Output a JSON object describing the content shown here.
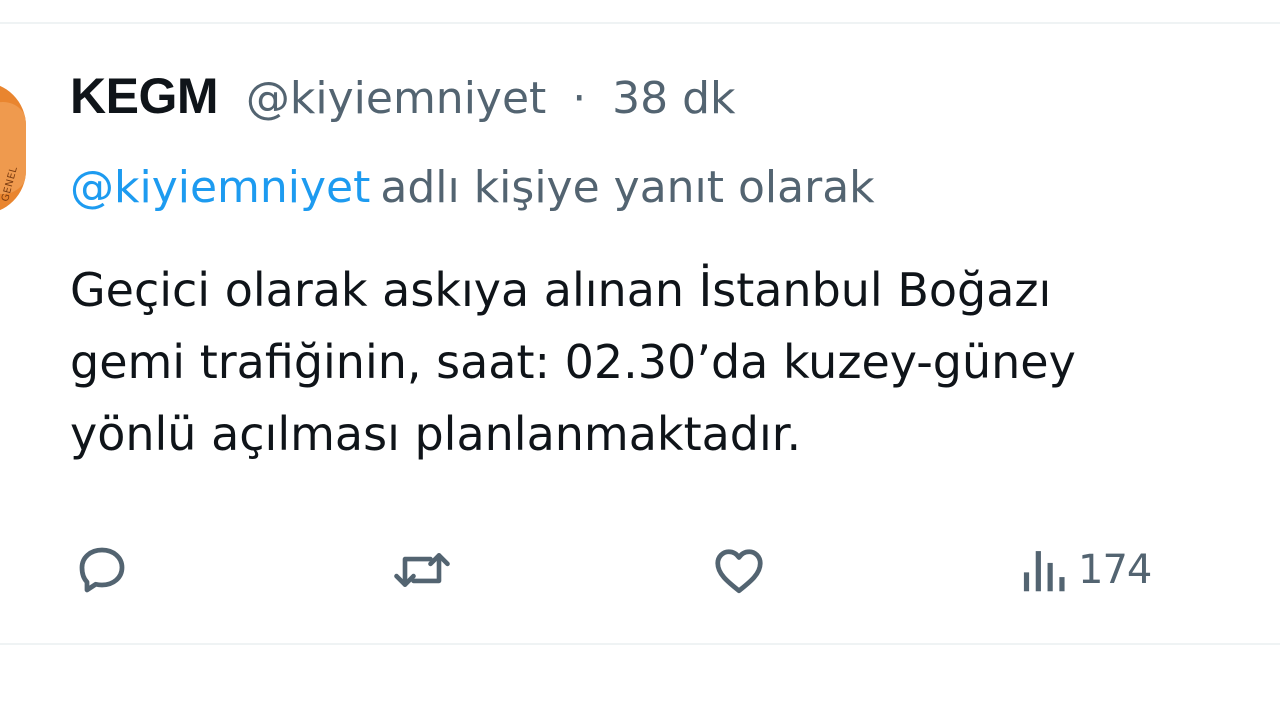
{
  "tweet": {
    "author_name": "KEGM",
    "author_handle": "@kiyiemniyet",
    "separator": "·",
    "timestamp": "38 dk",
    "avatar_text": "GENEL",
    "reply_to_handle": "@kiyiemniyet",
    "reply_suffix": "adlı kişiye yanıt olarak",
    "body_lines": [
      "Geçici olarak askıya alınan İstanbul Boğazı",
      "gemi trafiğinin, saat: 02.30’da kuzey-güney",
      "yönlü açılması planlanmaktadır."
    ],
    "views_count": "174"
  },
  "icons": {
    "reply": "reply-icon",
    "retweet": "retweet-icon",
    "like": "heart-icon",
    "views": "views-icon"
  },
  "colors": {
    "primary_text": "#0f1419",
    "secondary_text": "#536471",
    "link": "#1d9bf0",
    "avatar": "#e9852f"
  }
}
